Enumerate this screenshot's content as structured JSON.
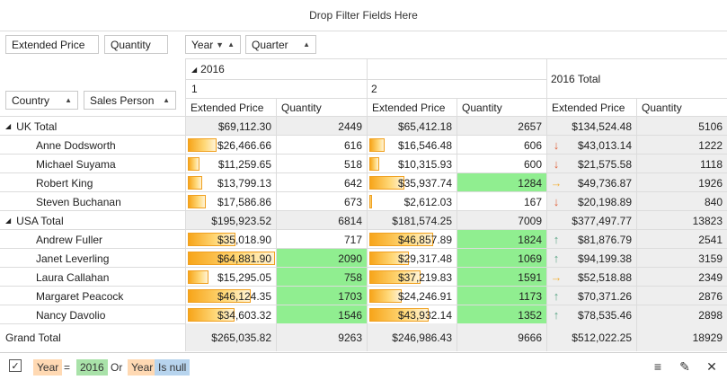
{
  "filter_area": {
    "text": "Drop Filter Fields Here"
  },
  "data_fields": {
    "extended_price": "Extended Price",
    "quantity": "Quantity"
  },
  "column_fields": {
    "year": "Year",
    "quarter": "Quarter"
  },
  "row_fields": {
    "country": "Country",
    "sales_person": "Sales Person"
  },
  "column_headers": {
    "year_value": "2016",
    "quarter1": "1",
    "quarter2": "2",
    "total": "2016 Total",
    "measures": [
      "Extended Price",
      "Quantity",
      "Extended Price",
      "Quantity",
      "Extended Price",
      "Quantity"
    ]
  },
  "rows": [
    {
      "label": "UK Total",
      "type": "group",
      "cells": [
        "$69,112.30",
        "2449",
        "$65,412.18",
        "2657",
        "$134,524.48",
        "5106"
      ]
    },
    {
      "label": "Anne Dodsworth",
      "type": "item",
      "cells": [
        "$26,466.66",
        "616",
        "$16,546.48",
        "606",
        "$43,013.14",
        "1222"
      ],
      "bars": [
        0.33,
        0.18
      ],
      "green": [
        false,
        false
      ],
      "trend": "down"
    },
    {
      "label": "Michael Suyama",
      "type": "item",
      "cells": [
        "$11,259.65",
        "518",
        "$10,315.93",
        "600",
        "$21,575.58",
        "1118"
      ],
      "bars": [
        0.13,
        0.11
      ],
      "green": [
        false,
        false
      ],
      "trend": "down"
    },
    {
      "label": "Robert King",
      "type": "item",
      "cells": [
        "$13,799.13",
        "642",
        "$35,937.74",
        "1284",
        "$49,736.87",
        "1926"
      ],
      "bars": [
        0.16,
        0.41
      ],
      "green": [
        false,
        true
      ],
      "trend": "flat"
    },
    {
      "label": "Steven Buchanan",
      "type": "item",
      "cells": [
        "$17,586.86",
        "673",
        "$2,612.03",
        "167",
        "$20,198.89",
        "840"
      ],
      "bars": [
        0.21,
        0.02
      ],
      "green": [
        false,
        false
      ],
      "trend": "down"
    },
    {
      "label": "USA Total",
      "type": "group",
      "cells": [
        "$195,923.52",
        "6814",
        "$181,574.25",
        "7009",
        "$377,497.77",
        "13823"
      ]
    },
    {
      "label": "Andrew Fuller",
      "type": "item",
      "cells": [
        "$35,018.90",
        "717",
        "$46,857.89",
        "1824",
        "$81,876.79",
        "2541"
      ],
      "bars": [
        0.55,
        0.74
      ],
      "green": [
        false,
        true
      ],
      "trend": "up"
    },
    {
      "label": "Janet Leverling",
      "type": "item",
      "cells": [
        "$64,881.90",
        "2090",
        "$29,317.48",
        "1069",
        "$94,199.38",
        "3159"
      ],
      "bars": [
        1.0,
        0.46
      ],
      "green": [
        true,
        true
      ],
      "trend": "up"
    },
    {
      "label": "Laura Callahan",
      "type": "item",
      "cells": [
        "$15,295.05",
        "758",
        "$37,219.83",
        "1591",
        "$52,518.88",
        "2349"
      ],
      "bars": [
        0.24,
        0.59
      ],
      "green": [
        true,
        true
      ],
      "trend": "flat"
    },
    {
      "label": "Margaret Peacock",
      "type": "item",
      "cells": [
        "$46,124.35",
        "1703",
        "$24,246.91",
        "1173",
        "$70,371.26",
        "2876"
      ],
      "bars": [
        0.72,
        0.38
      ],
      "green": [
        true,
        true
      ],
      "trend": "up"
    },
    {
      "label": "Nancy Davolio",
      "type": "item",
      "cells": [
        "$34,603.32",
        "1546",
        "$43,932.14",
        "1352",
        "$78,535.46",
        "2898"
      ],
      "bars": [
        0.54,
        0.69
      ],
      "green": [
        true,
        true
      ],
      "trend": "up"
    }
  ],
  "grand_total": {
    "label": "Grand Total",
    "cells": [
      "$265,035.82",
      "9263",
      "$246,986.43",
      "9666",
      "$512,022.25",
      "18929"
    ]
  },
  "filter_expression": {
    "field1": "Year",
    "operator": "=",
    "value1": "2016",
    "or_text": "Or",
    "field2": "Year",
    "null_text": "Is null"
  },
  "icons": {
    "trend_up": "arrow-up-icon",
    "trend_down": "arrow-down-icon",
    "trend_flat": "arrow-right-icon",
    "colors": {
      "up": "#5aa585",
      "down": "#e0603a",
      "flat": "#f3b13c",
      "green": "#90ee90",
      "bar": "#f7a51a"
    }
  }
}
